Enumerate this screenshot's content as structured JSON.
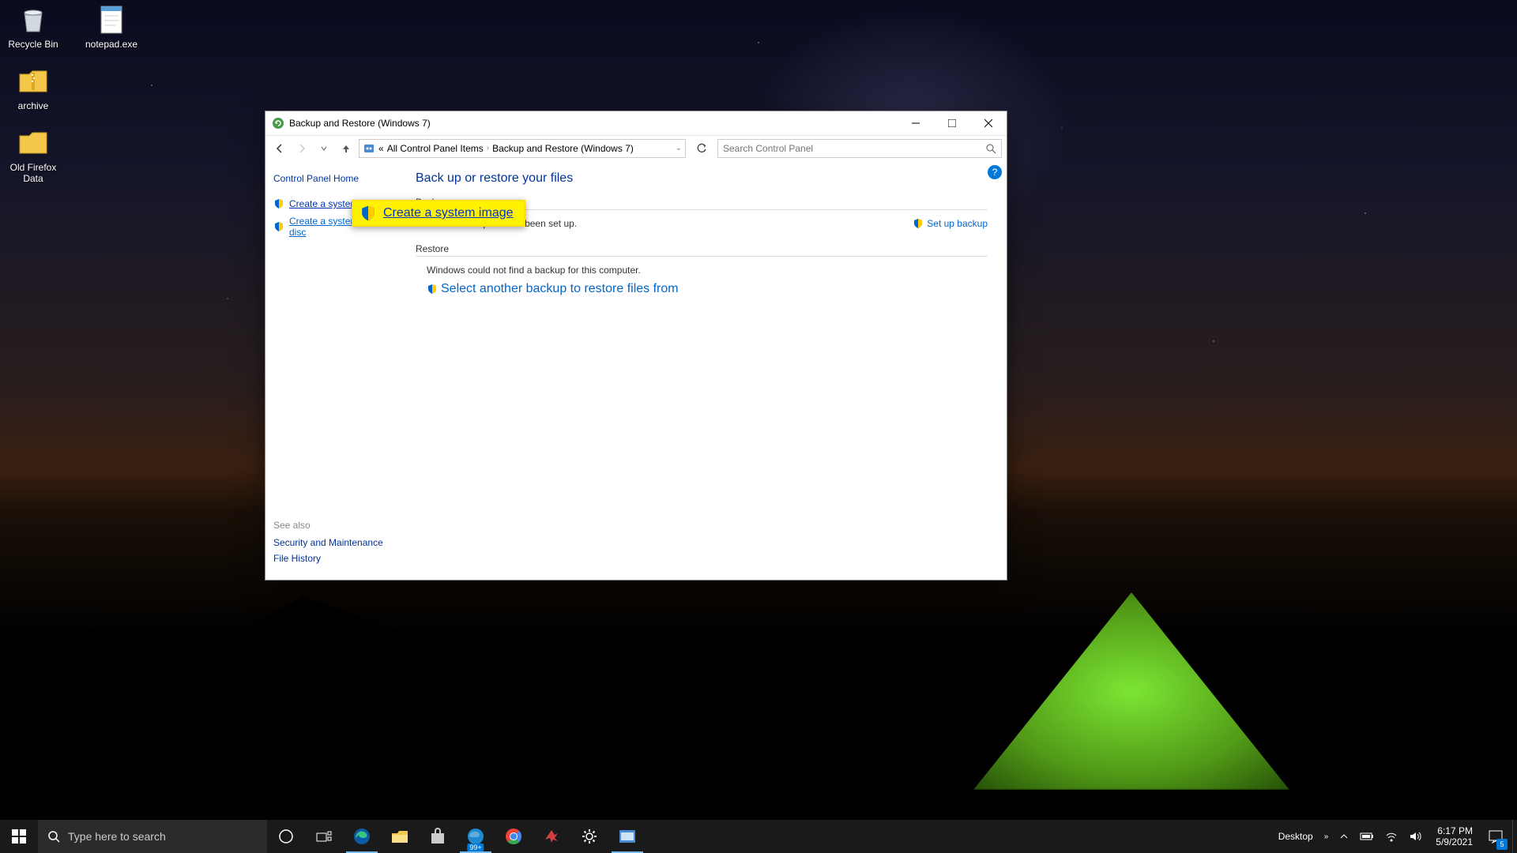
{
  "desktop_icons": {
    "recycle": "Recycle Bin",
    "notepad": "notepad.exe",
    "archive": "archive",
    "old_firefox": "Old Firefox Data"
  },
  "window": {
    "title": "Backup and Restore (Windows 7)",
    "breadcrumb": {
      "prefix": "«",
      "b1": "All Control Panel Items",
      "b2": "Backup and Restore (Windows 7)"
    },
    "search_placeholder": "Search Control Panel",
    "sidebar": {
      "home": "Control Panel Home",
      "create_image": "Create a system image",
      "create_repair": "Create a system repair disc"
    },
    "content": {
      "heading": "Back up or restore your files",
      "backup_label": "Backup",
      "backup_msg": "Windows Backup has not been set up.",
      "setup_backup": "Set up backup",
      "restore_label": "Restore",
      "restore_msg": "Windows could not find a backup for this computer.",
      "select_another": "Select another backup to restore files from"
    },
    "footer": {
      "see_also": "See also",
      "security": "Security and Maintenance",
      "file_history": "File History"
    }
  },
  "callout_text": "Create a system image",
  "taskbar": {
    "search_placeholder": "Type here to search",
    "ie_badge": "99+",
    "desktop_label": "Desktop",
    "time": "6:17 PM",
    "date": "5/9/2021",
    "notif_count": "5"
  }
}
